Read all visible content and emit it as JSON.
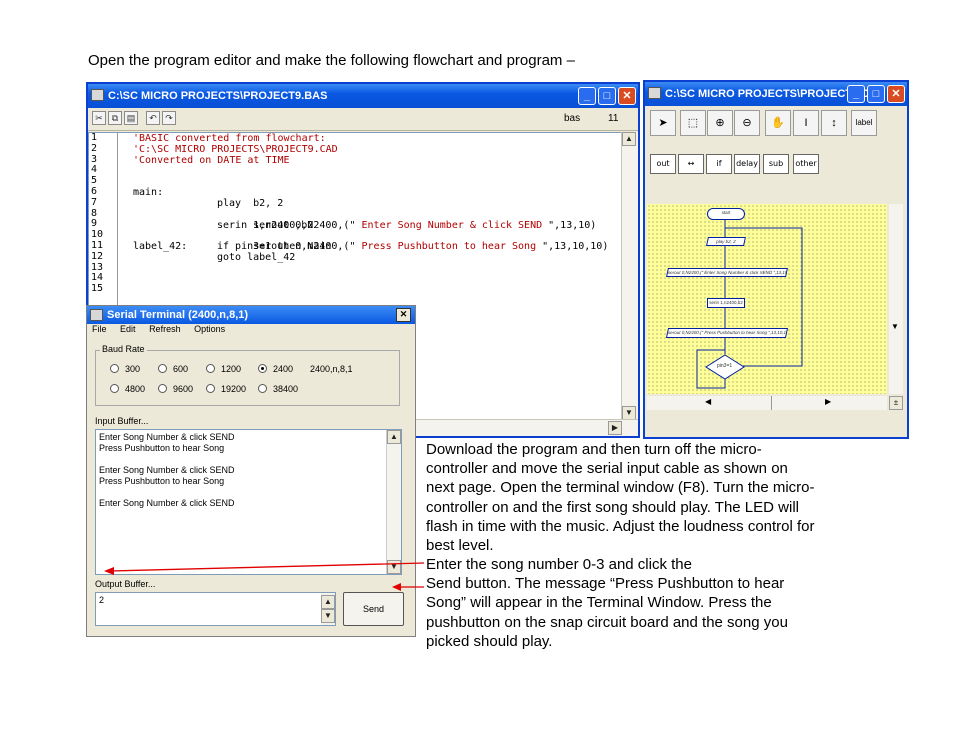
{
  "heading": "Open the program editor and make the following flowchart and program –",
  "editor": {
    "title": "C:\\SC MICRO PROJECTS\\PROJECT9.BAS",
    "tb_icons": [
      "cut-icon",
      "copy-icon",
      "paste-icon",
      "undo-icon",
      "redo-icon"
    ],
    "file_type": "bas",
    "line_count": "11",
    "line_numbers": [
      "1",
      "2",
      "3",
      "4",
      "5",
      "6",
      "7",
      "8",
      "9",
      "10",
      "11",
      "12",
      "13",
      "14",
      "15"
    ],
    "code": {
      "c1": "'BASIC converted from flowchart:",
      "c2": "'C:\\SC MICRO PROJECTS\\PROJECT9.CAD",
      "c3": "'Converted on DATE at TIME",
      "main": "main:",
      "l7": "play  b2, 2",
      "l8a": "serout 0,N2400,(\"",
      "l8b": " Enter Song Number & click SEND ",
      "l8c": "\",13,10)",
      "l9": "serin 1,n2400,b2",
      "l10a": "serout 0,N2400,(\"",
      "l10b": " Press Pushbutton to hear Song ",
      "l10c": "\",13,10,10)",
      "l11label": "label_42:",
      "l11": "if pin3=1 then main",
      "l12": "goto label_42"
    }
  },
  "cad": {
    "title": "C:\\SC MICRO PROJECTS\\PROJECT9.CAD",
    "tools": [
      "▲",
      "▲",
      "⊕",
      "⊕",
      "✋",
      "I",
      "↕",
      "label"
    ],
    "label_tool": "label",
    "symbols": [
      "out",
      "↔",
      "if",
      "delay",
      "sub",
      "other"
    ],
    "flow": {
      "start": "start",
      "play": "play b2, 2",
      "serout1": "serout 0,N2400,(\" Enter Song Number & click SEND \",13,10)",
      "serin": "serin 1,n2400,b2",
      "serout2": "serout 0,N2400,(\" Press Pushbutton to hear Song \",13,10,10)",
      "pin": "pin3=1"
    }
  },
  "terminal": {
    "title": "Serial Terminal (2400,n,8,1)",
    "menu": [
      "File",
      "Edit",
      "Refresh",
      "Options"
    ],
    "baud_label": "Baud Rate",
    "baud_row1": [
      "300",
      "600",
      "1200",
      "2400"
    ],
    "baud_row2": [
      "4800",
      "9600",
      "19200",
      "38400"
    ],
    "selected_baud": "2400",
    "setting": "2400,n,8,1",
    "input_label": "Input Buffer...",
    "input_lines": [
      "Enter Song Number & click SEND",
      "Press Pushbutton to hear Song",
      "",
      "Enter Song Number & click SEND",
      "Press Pushbutton to hear Song",
      "",
      "Enter Song Number & click SEND"
    ],
    "output_label": "Output Buffer...",
    "output_value": "2",
    "send_label": "Send"
  },
  "description": {
    "p1": [
      "Download the program and then turn off the micro-",
      "controller and move the serial input cable as shown on",
      "next page. Open the terminal window (F8). Turn the micro-",
      "controller on and the first song should play. The LED will",
      "flash in time with the music. Adjust the loudness control for",
      "best level."
    ],
    "p2": [
      "Enter the song number 0-3 and click the",
      "Send button. The message “Press Pushbutton to hear",
      "Song” will appear in the Terminal Window. Press the",
      "pushbutton on the snap circuit board and the song you",
      "picked should play."
    ]
  },
  "colors": {
    "title_blue": "#0a58e2",
    "grid_yellow": "#ffff99",
    "code_red": "#b00000",
    "arrow_red": "#e00000"
  }
}
